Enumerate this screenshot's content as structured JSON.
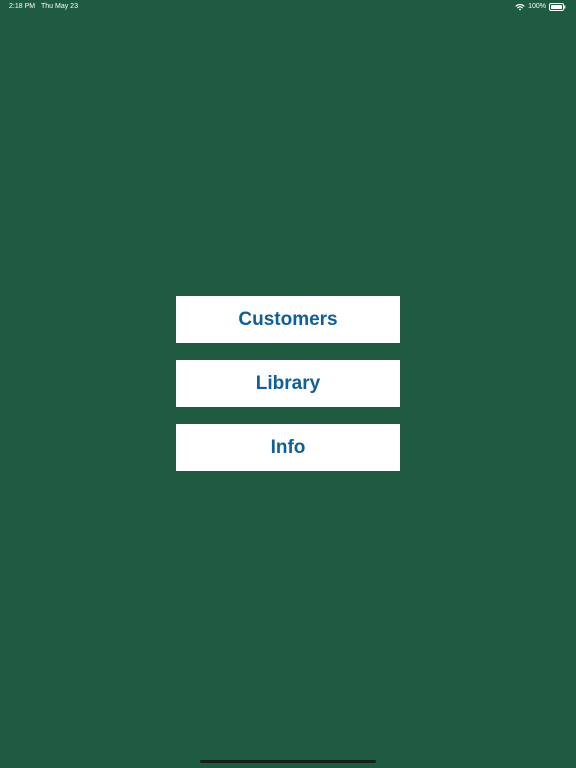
{
  "status_bar": {
    "time": "2:18 PM",
    "date": "Thu May 23",
    "battery_percent": "100%",
    "icons": [
      "wifi-icon",
      "battery-icon"
    ]
  },
  "menu": {
    "customers_label": "Customers",
    "library_label": "Library",
    "info_label": "Info"
  },
  "colors": {
    "background": "#1e5b41",
    "button_background": "#ffffff",
    "button_text": "#0f5f99",
    "status_text": "#ffffff"
  }
}
